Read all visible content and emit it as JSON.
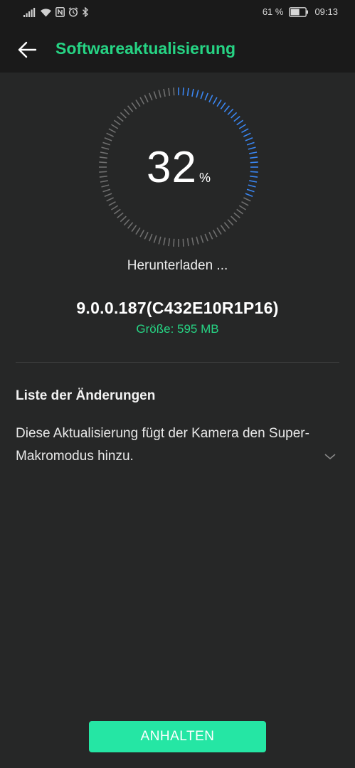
{
  "status_bar": {
    "battery_percent": "61 %",
    "time": "09:13",
    "battery_level": 0.61,
    "icons": [
      "signal-icon",
      "wifi-icon",
      "nfc-icon",
      "alarm-icon",
      "bluetooth-icon",
      "battery-icon"
    ]
  },
  "app_bar": {
    "title": "Softwareaktualisierung",
    "back_icon": "arrow-left-icon"
  },
  "progress": {
    "value": "32",
    "unit": "%",
    "fraction": 0.32,
    "status": "Herunterladen ..."
  },
  "update": {
    "version": "9.0.0.187(C432E10R1P16)",
    "size": "Größe: 595 MB"
  },
  "changes": {
    "heading": "Liste der Änderungen",
    "body": "Diese Aktualisierung fügt der Kamera den Super-Makromodus hinzu.",
    "expand_icon": "chevron-down-icon"
  },
  "actions": {
    "pause_label": "ANHALTEN"
  },
  "colors": {
    "accent": "#26d484",
    "button": "#25e6a4",
    "progress_ticks": "#3a86f2",
    "idle_ticks": "#6f6f6f",
    "background": "#262727",
    "bar": "#1a1a1a"
  }
}
